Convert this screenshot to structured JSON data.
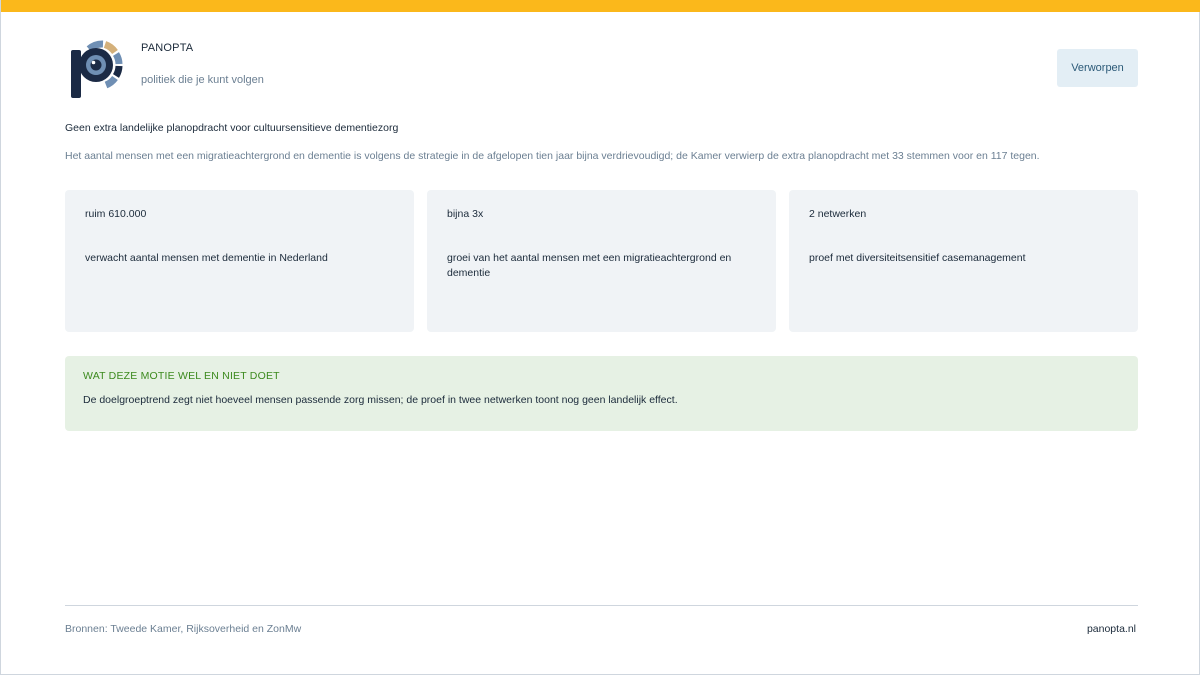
{
  "brand": {
    "name": "PANOPTA",
    "tagline": "politiek die je kunt volgen"
  },
  "status": {
    "label": "Verworpen"
  },
  "motion": {
    "title": "Geen extra landelijke planopdracht voor cultuursensitieve dementiezorg",
    "summary": "Het aantal mensen met een migratieachtergrond en dementie is volgens de strategie in de afgelopen tien jaar bijna verdrievoudigd; de Kamer verwierp de extra planopdracht met 33 stemmen voor en 117 tegen."
  },
  "stats": [
    {
      "value": "ruim 610.000",
      "description": "verwacht aantal mensen met dementie in Nederland"
    },
    {
      "value": "bijna 3x",
      "description": "groei van het aantal mensen met een migratieachtergrond en dementie"
    },
    {
      "value": "2 netwerken",
      "description": "proef met diversiteitsensitief casemanagement"
    }
  ],
  "note": {
    "heading": "WAT DEZE MOTIE WEL EN NIET DOET",
    "text": "De doelgroeptrend zegt niet hoeveel mensen passende zorg missen; de proef in twee netwerken toont nog geen landelijk effect."
  },
  "footer": {
    "sources": "Bronnen: Tweede Kamer, Rijksoverheid en ZonMw",
    "site": "panopta.nl"
  },
  "colors": {
    "accent_bar": "#fbb81b",
    "logo_dark": "#1b2a45",
    "logo_tan": "#d4b07a",
    "logo_blue": "#6f8fb4",
    "note_heading": "#3c8a1e",
    "note_background": "#e6f1e4",
    "status_background": "#e3eef5"
  }
}
